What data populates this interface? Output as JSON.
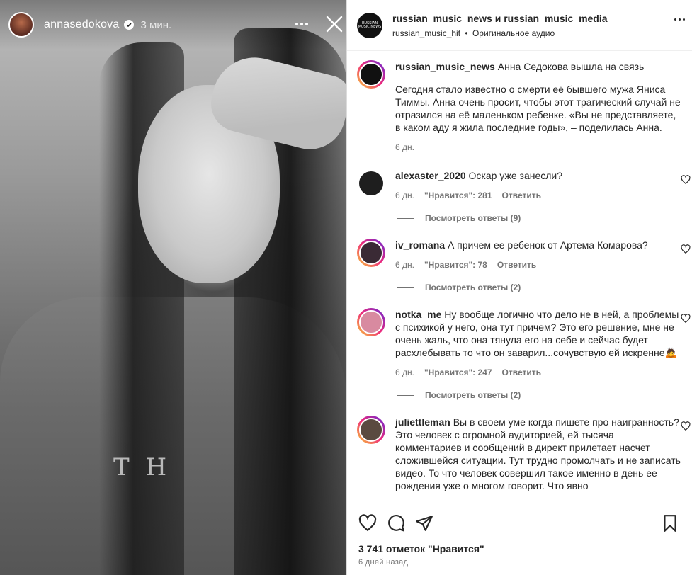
{
  "story": {
    "username": "annasedokova",
    "time": "3 мин.",
    "shirt_text": "T H"
  },
  "post": {
    "header_title": "russian_music_news и russian_music_media",
    "header_sub_account": "russian_music_hit",
    "header_sub_dot": "•",
    "header_sub_audio": "Оригинальное аудио",
    "logo_text": "RUSSIAN MUSIC NEWS"
  },
  "caption": {
    "username": "russian_music_news",
    "headline": "Анна Седокова вышла на связь",
    "text": "Сегодня стало известно о смерти её бывшего мужа Яниса Тиммы. Анна очень просит, чтобы этот трагический случай не отразился на её маленьком ребенке. «Вы не представляете, в каком аду я жила последние годы», – поделилась Анна.",
    "time": "6 дн."
  },
  "comments": [
    {
      "username": "alexaster_2020",
      "text": "Оскар уже занесли?",
      "time": "6 дн.",
      "likes": "\"Нравится\": 281",
      "reply": "Ответить",
      "view_replies": "Посмотреть ответы (9)",
      "avatar_color": "#1e1e1e",
      "ring": false
    },
    {
      "username": "iv_romana",
      "text": "А причем ее ребенок от Артема Комарова?",
      "time": "6 дн.",
      "likes": "\"Нравится\": 78",
      "reply": "Ответить",
      "view_replies": "Посмотреть ответы (2)",
      "avatar_color": "#3a2a35",
      "ring": true
    },
    {
      "username": "notka_me",
      "text": "Ну вообще логично что дело не в ней, а проблемы с психикой у него, она тут причем? Это его решение, мне не очень жаль, что она тянула его на себе и сейчас будет расхлебывать то что он заварил...сочувствую ей искренне🙇",
      "time": "6 дн.",
      "likes": "\"Нравится\": 247",
      "reply": "Ответить",
      "view_replies": "Посмотреть ответы (2)",
      "avatar_color": "#d88aa0",
      "ring": true
    },
    {
      "username": "juliettleman",
      "text": "Вы в своем уме когда пишете про наигранность? Это человек с огромной аудиторией, ей тысяча комментариев и сообщений в директ прилетает насчет сложившейся ситуации. Тут трудно промолчать и не записать видео. То что человек совершил такое именно в день ее рождения уже о многом говорит. Что явно",
      "avatar_color": "#5a4a40",
      "ring": true
    }
  ],
  "footer": {
    "likes": "3 741 отметок \"Нравится\"",
    "time": "6 дней назад"
  },
  "colors": {
    "text": "#262626",
    "muted": "#737373",
    "ring_gradient": [
      "#f9ce34",
      "#ee2a7b",
      "#6228d7"
    ]
  },
  "icons": [
    "verified-icon",
    "more-icon",
    "close-icon",
    "heart-icon",
    "comment-icon",
    "share-icon",
    "save-icon"
  ]
}
